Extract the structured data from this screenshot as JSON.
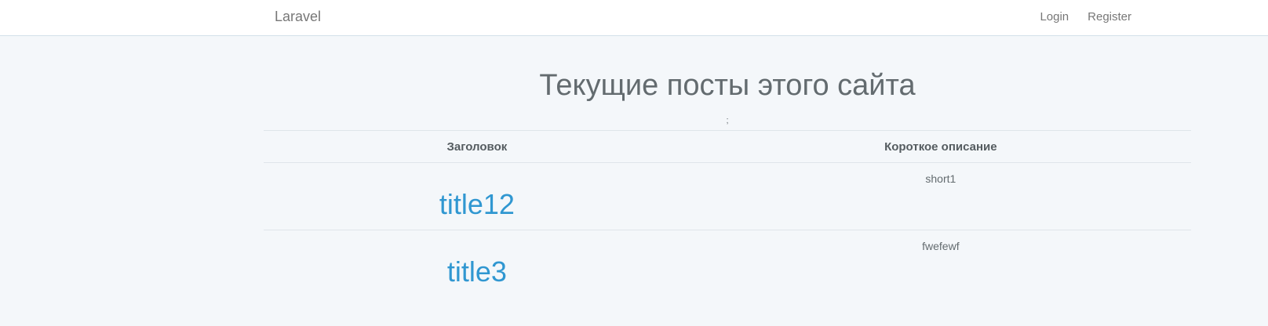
{
  "navbar": {
    "brand": "Laravel",
    "links": [
      "Login",
      "Register"
    ]
  },
  "page": {
    "heading": "Текущие посты этого сайта",
    "separator": ";"
  },
  "table": {
    "headers": [
      "Заголовок",
      "Короткое описание"
    ],
    "rows": [
      {
        "title": "title12",
        "short": "short1"
      },
      {
        "title": "title3",
        "short": "fwefewf"
      }
    ]
  },
  "colors": {
    "accent": "#3097d1",
    "background": "#f4f7fa",
    "text": "#636b6f"
  }
}
